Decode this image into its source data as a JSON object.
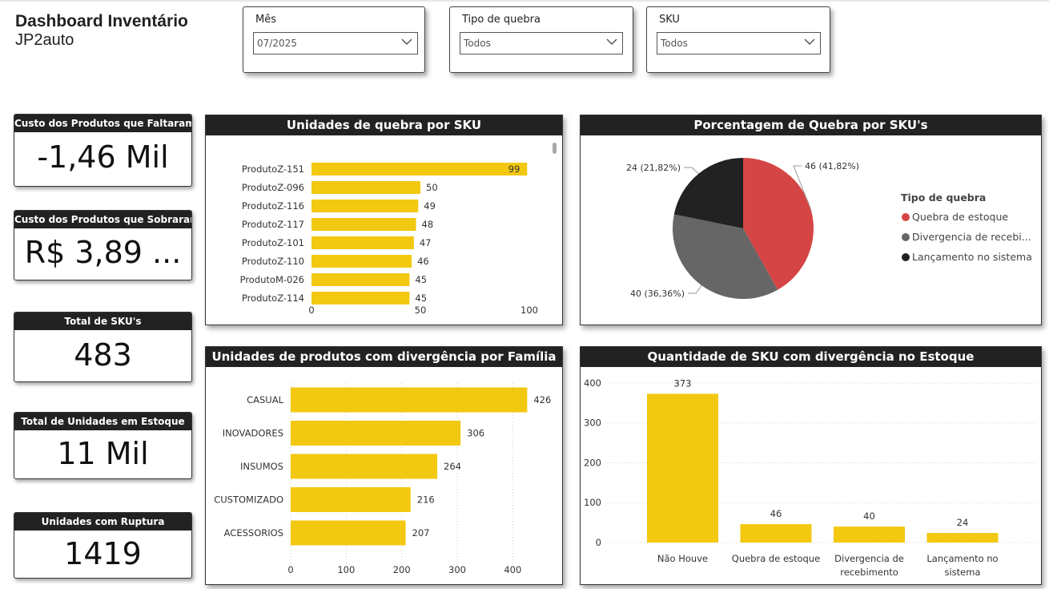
{
  "header": {
    "title": "Dashboard Inventário",
    "subtitle": "JP2auto"
  },
  "filters": {
    "month": {
      "label": "Mês",
      "value": "07/2025"
    },
    "break_type": {
      "label": "Tipo de quebra",
      "value": "Todos"
    },
    "sku": {
      "label": "SKU",
      "value": "Todos"
    }
  },
  "kpis": {
    "missing_cost": {
      "label": "Custo dos Produtos que Faltaram",
      "value": "-1,46 Mil"
    },
    "surplus_cost": {
      "label": "Custo dos Produtos que Sobraram",
      "value": "R$ 3,89 ..."
    },
    "total_sku": {
      "label": "Total de SKU's",
      "value": "483"
    },
    "stock_units": {
      "label": "Total de Unidades em Estoque",
      "value": "11 Mil"
    },
    "rupture_units": {
      "label": "Unidades com Ruptura",
      "value": "1419"
    }
  },
  "panels": {
    "by_sku": "Unidades de quebra por SKU",
    "pct": "Porcentagem de Quebra por SKU's",
    "family": "Unidades de produtos com divergência por Família",
    "stock": "Quantidade de SKU com divergência no Estoque"
  },
  "colors": {
    "accent": "#F2C811",
    "red": "#D64545",
    "gray": "#666666",
    "dark": "#222222"
  },
  "chart_data": [
    {
      "type": "bar",
      "orientation": "horizontal",
      "title": "Unidades de quebra por SKU",
      "categories": [
        "ProdutoZ-151",
        "ProdutoZ-096",
        "ProdutoZ-116",
        "ProdutoZ-117",
        "ProdutoZ-101",
        "ProdutoZ-110",
        "ProdutoM-026",
        "ProdutoZ-114"
      ],
      "values": [
        99,
        50,
        49,
        48,
        47,
        46,
        45,
        45
      ],
      "xlim": [
        0,
        100
      ],
      "xticks": [
        0,
        50,
        100
      ],
      "scrollbar": true
    },
    {
      "type": "pie",
      "title": "Porcentagem de Quebra por SKU's",
      "legend_title": "Tipo de quebra",
      "legend_position": "right",
      "slices": [
        {
          "name": "Quebra de estoque",
          "legend_label": "Quebra de estoque",
          "value": 46,
          "label": "46 (41,82%)",
          "color": "#D64545"
        },
        {
          "name": "Divergencia de recebimento",
          "legend_label": "Divergencia de recebi...",
          "value": 40,
          "label": "40 (36,36%)",
          "color": "#666666"
        },
        {
          "name": "Lançamento no sistema",
          "legend_label": "Lançamento no sistema",
          "value": 24,
          "label": "24 (21,82%)",
          "color": "#222222"
        }
      ]
    },
    {
      "type": "bar",
      "orientation": "horizontal",
      "title": "Unidades de produtos com divergência por Família",
      "categories": [
        "CASUAL",
        "INOVADORES",
        "INSUMOS",
        "CUSTOMIZADO",
        "ACESSORIOS"
      ],
      "values": [
        426,
        306,
        264,
        216,
        207
      ],
      "xlim": [
        0,
        450
      ],
      "xticks": [
        0,
        100,
        200,
        300,
        400
      ],
      "grid": true
    },
    {
      "type": "bar",
      "orientation": "vertical",
      "title": "Quantidade de SKU com divergência no Estoque",
      "categories": [
        [
          "Não Houve"
        ],
        [
          "Quebra de estoque"
        ],
        [
          "Divergencia de",
          "recebimento"
        ],
        [
          "Lançamento no",
          "sistema"
        ]
      ],
      "values": [
        373,
        46,
        40,
        24
      ],
      "ylim": [
        0,
        410
      ],
      "yticks": [
        0,
        100,
        200,
        300,
        400
      ],
      "grid": true
    }
  ]
}
